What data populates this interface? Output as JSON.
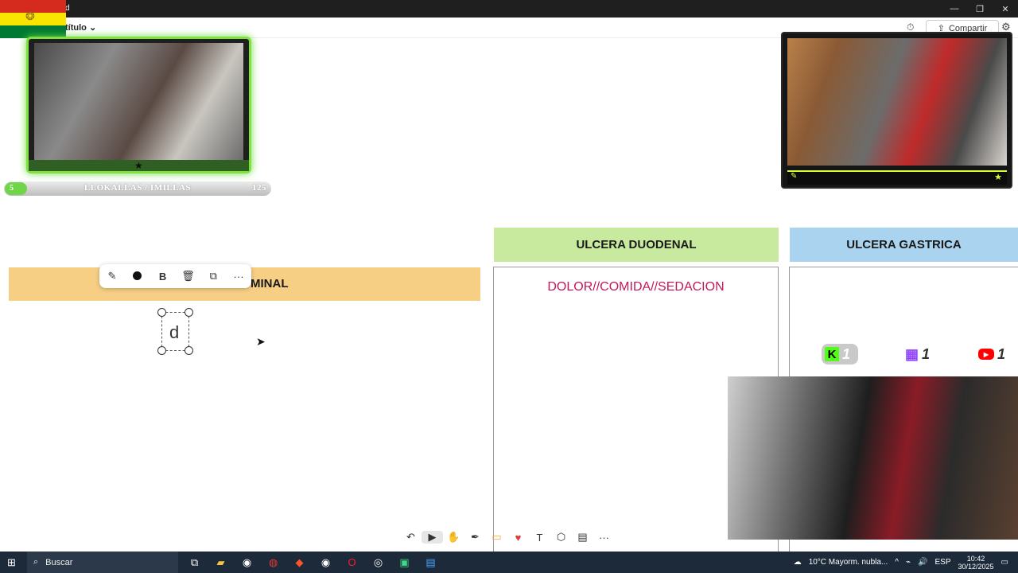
{
  "window": {
    "title": "d",
    "doc_name": "título",
    "share_label": "Compartir",
    "controls": [
      "—",
      "❐",
      "✕"
    ]
  },
  "overlays": {
    "player": {
      "level": "5",
      "name": "LLOKALLAS / IMILLAS",
      "count": "125"
    },
    "social": [
      {
        "platform": "kick",
        "icon": "K",
        "count": "1"
      },
      {
        "platform": "twitch",
        "icon": "▦",
        "count": "1"
      },
      {
        "platform": "youtube",
        "icon": "▶",
        "count": "1"
      }
    ]
  },
  "board": {
    "left_header": "MINAL",
    "duodenal_header": "ULCERA DUODENAL",
    "gastric_header": "ULCERA GASTRICA",
    "duodenal_text": "DOLOR//COMIDA//SEDACION",
    "selected_text": "d"
  },
  "context_toolbar": [
    "✎",
    "●",
    "B",
    "🗑",
    "⧉",
    "···"
  ],
  "bottom_toolbar": [
    "↶",
    "▶",
    "✋",
    "✒",
    "▭",
    "♥",
    "T",
    "⬡",
    "▤",
    "···"
  ],
  "taskbar": {
    "search_placeholder": "Buscar",
    "weather": "10°C  Mayorm. nubla...",
    "lang": "ESP",
    "time": "10:42",
    "date": "30/12/2025"
  },
  "colors": {
    "left_header_bg": "#f6cf85",
    "duodenal_header_bg": "#c8ea9e",
    "gastric_header_bg": "#a9d3ef",
    "duodenal_text": "#c2185b",
    "cam_border": "#7ee13f"
  }
}
